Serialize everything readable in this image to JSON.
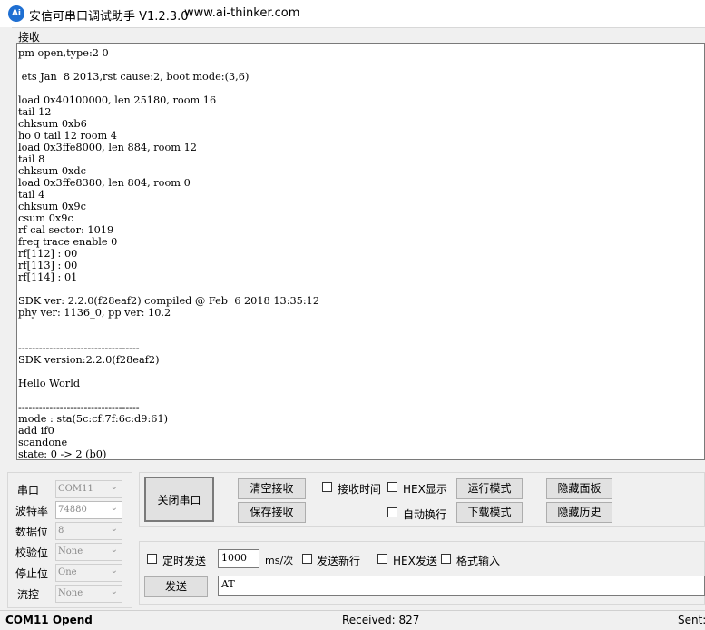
{
  "window": {
    "title": "安信可串口调试助手 V1.2.3.0",
    "url": "www.ai-thinker.com",
    "logo_text": "Ai"
  },
  "receive": {
    "label": "接收",
    "text": "pm open,type:2 0\n\n ets Jan  8 2013,rst cause:2, boot mode:(3,6)\n\nload 0x40100000, len 25180, room 16\ntail 12\nchksum 0xb6\nho 0 tail 12 room 4\nload 0x3ffe8000, len 884, room 12\ntail 8\nchksum 0xdc\nload 0x3ffe8380, len 804, room 0\ntail 4\nchksum 0x9c\ncsum 0x9c\nrf cal sector: 1019\nfreq trace enable 0\nrf[112] : 00\nrf[113] : 00\nrf[114] : 01\n\nSDK ver: 2.2.0(f28eaf2) compiled @ Feb  6 2018 13:35:12\nphy ver: 1136_0, pp ver: 10.2\n\n\n-----------------------------------\nSDK version:2.2.0(f28eaf2)\n\nHello World\n\n-----------------------------------\nmode : sta(5c:cf:7f:6c:d9:61)\nadd if0\nscandone\nstate: 0 -> 2 (b0)"
  },
  "settings": {
    "port": {
      "label": "串口",
      "value": "COM11"
    },
    "baud": {
      "label": "波特率",
      "value": "74880"
    },
    "databits": {
      "label": "数据位",
      "value": "8"
    },
    "parity": {
      "label": "校验位",
      "value": "None"
    },
    "stopbits": {
      "label": "停止位",
      "value": "One"
    },
    "flow": {
      "label": "流控",
      "value": "None"
    }
  },
  "buttons": {
    "close_port": "关闭串口",
    "clear_receive": "清空接收",
    "save_receive": "保存接收",
    "run_mode": "运行模式",
    "download_mode": "下载模式",
    "hide_panel": "隐藏面板",
    "hide_history": "隐藏历史",
    "send": "发送"
  },
  "options": {
    "receive_time": "接收时间",
    "hex_display": "HEX显示",
    "auto_wrap": "自动换行",
    "timed_send": "定时发送",
    "interval_value": "1000",
    "interval_unit": "ms/次",
    "send_newline": "发送新行",
    "hex_send": "HEX发送",
    "format_input": "格式输入"
  },
  "send_input": {
    "value": "AT"
  },
  "status": {
    "port_state": "COM11 Opend",
    "received": "Received: 827",
    "sent": "Sent:"
  }
}
